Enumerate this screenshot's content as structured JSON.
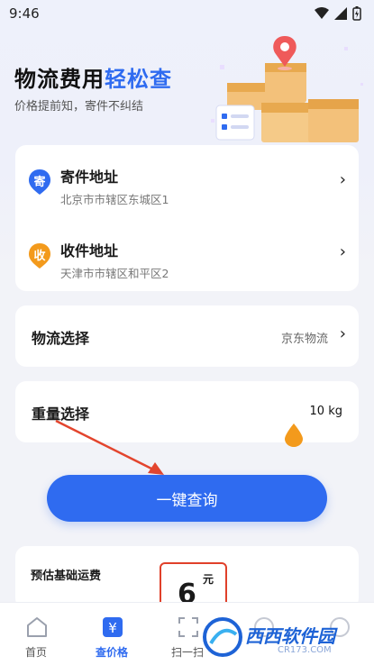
{
  "status_bar": {
    "time": "9:46"
  },
  "hero": {
    "title_main": "物流费用",
    "title_accent": "轻松查",
    "subtitle": "价格提前知，寄件不纠结",
    "accent_color": "#2f6bf0"
  },
  "address": {
    "sender": {
      "badge": "寄",
      "title": "寄件地址",
      "detail": "北京市市辖区东城区1",
      "badge_color": "#2f6bf0"
    },
    "receiver": {
      "badge": "收",
      "title": "收件地址",
      "detail": "天津市市辖区和平区2",
      "badge_color": "#f39a1c"
    }
  },
  "logistics": {
    "label": "物流选择",
    "value": "京东物流"
  },
  "weight": {
    "label": "重量选择",
    "value": "10 kg"
  },
  "query_button": {
    "label": "一键查询"
  },
  "estimate": {
    "label": "预估基础运费",
    "amount": "6",
    "unit": "元"
  },
  "bottom_nav": {
    "items": [
      {
        "label": "首页",
        "icon": "home-icon"
      },
      {
        "label": "查价格",
        "icon": "yuan-icon"
      },
      {
        "label": "扫一扫",
        "icon": "scan-icon"
      },
      {
        "label": "",
        "icon": "more-icon"
      },
      {
        "label": "",
        "icon": "profile-icon"
      }
    ]
  },
  "watermark": {
    "text": "西西软件园",
    "url": "CR173.COM"
  }
}
